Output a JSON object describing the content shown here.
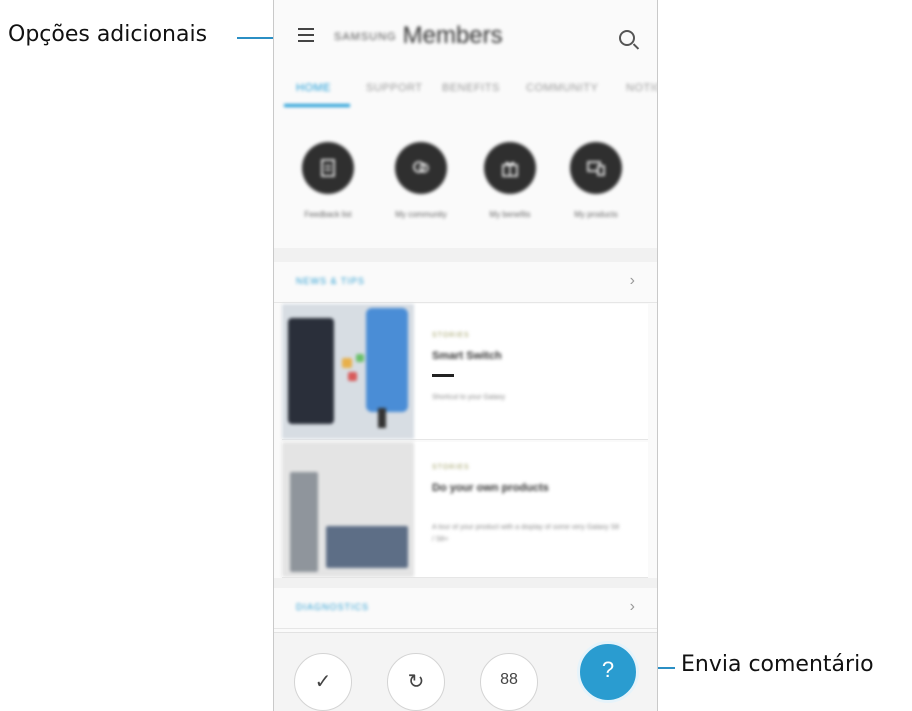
{
  "callouts": {
    "left": "Opções adicionais",
    "right": "Envia comentário"
  },
  "header": {
    "brand": "SAMSUNG",
    "title": "Members"
  },
  "tabs": [
    "HOME",
    "SUPPORT",
    "BENEFITS",
    "COMMUNITY",
    "NOTICES"
  ],
  "quick_actions": [
    "Feedback list",
    "My community",
    "My benefits",
    "My products"
  ],
  "sections": {
    "news": {
      "title": "NEWS & TIPS"
    },
    "diagnostics": {
      "title": "DIAGNOSTICS"
    }
  },
  "articles": [
    {
      "category": "STORIES",
      "title": "Smart Switch",
      "description": "Shortcut to your Galaxy"
    },
    {
      "category": "STORIES",
      "title": "Do your own products",
      "description": "A tour of your product with a display of some very Galaxy S8 / S8+"
    }
  ],
  "bottom_bar": {
    "buttons": [
      "✓",
      "↻",
      "88"
    ],
    "fab": "?"
  },
  "colors": {
    "accent": "#2a9cd0",
    "callout_line": "#2b8fc4"
  }
}
